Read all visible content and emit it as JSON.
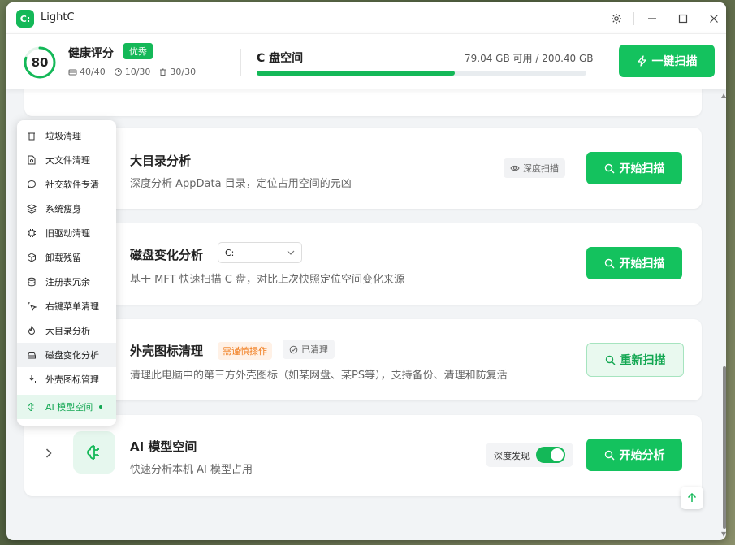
{
  "app": {
    "title": "LightC",
    "logo_letter": "C:"
  },
  "header": {
    "score": "80",
    "score_fraction": 0.8,
    "health_title": "健康评分",
    "health_badge": "优秀",
    "stats": [
      "40/40",
      "10/30",
      "30/30"
    ],
    "disk_title": "C 盘空间",
    "disk_free": "79.04 GB 可用 / 200.40 GB",
    "disk_used_fraction": 0.6,
    "onekey_label": "一键扫描"
  },
  "cards": {
    "bigdir": {
      "title": "大目录分析",
      "desc": "深度分析 AppData 目录，定位占用空间的元凶",
      "tag": "深度扫描",
      "button": "开始扫描"
    },
    "diskchange": {
      "title": "磁盘变化分析",
      "drive": "C:",
      "desc": "基于 MFT 快速扫描 C 盘，对比上次快照定位空间变化来源",
      "button": "开始扫描"
    },
    "shellicon": {
      "title": "外壳图标清理",
      "warn_tag": "需谨慎操作",
      "done_tag": "已清理",
      "desc": "清理此电脑中的第三方外壳图标（如某网盘、某PS等），支持备份、清理和防复活",
      "button": "重新扫描"
    },
    "aimodel": {
      "title": "AI 模型空间",
      "desc": "快速分析本机 AI 模型占用",
      "toggle_label": "深度发现",
      "button": "开始分析"
    }
  },
  "menu": {
    "items": [
      "垃圾清理",
      "大文件清理",
      "社交软件专清",
      "系统瘦身",
      "旧驱动清理",
      "卸载残留",
      "注册表冗余",
      "右键菜单清理",
      "大目录分析",
      "磁盘变化分析",
      "外壳图标管理",
      "AI 模型空间"
    ]
  },
  "colors": {
    "accent": "#14c25e",
    "warn": "#f07a1a"
  }
}
